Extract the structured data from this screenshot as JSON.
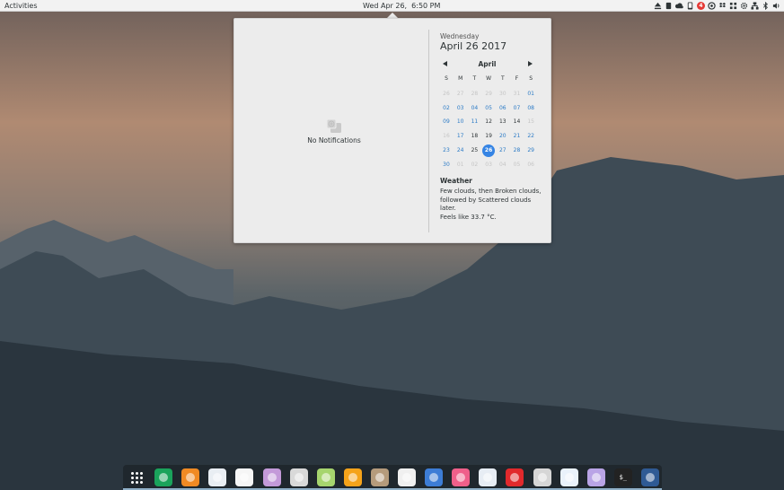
{
  "topbar": {
    "activities_label": "Activities",
    "clock": "Wed Apr 26,  6:50 PM",
    "tray": {
      "notification_count": "4",
      "icons": [
        "eject-icon",
        "battery-icon",
        "cloud-icon",
        "phone-icon",
        "notification-badge",
        "steam-icon",
        "dropbox-icon",
        "grid-apps-icon",
        "settings-cog-icon",
        "network-icon",
        "bluetooth-icon",
        "volume-icon"
      ]
    }
  },
  "notifications": {
    "empty_label": "No Notifications"
  },
  "calendar": {
    "weekday": "Wednesday",
    "full_date": "April 26 2017",
    "month": "April",
    "day_headers": [
      "S",
      "M",
      "T",
      "W",
      "T",
      "F",
      "S"
    ],
    "weeks": [
      [
        {
          "d": "26",
          "o": true
        },
        {
          "d": "27",
          "o": true
        },
        {
          "d": "28",
          "o": true
        },
        {
          "d": "29",
          "o": true
        },
        {
          "d": "30",
          "o": true
        },
        {
          "d": "31",
          "o": true
        },
        {
          "d": "01",
          "w": true
        }
      ],
      [
        {
          "d": "02",
          "w": true
        },
        {
          "d": "03",
          "w": true
        },
        {
          "d": "04",
          "w": true
        },
        {
          "d": "05",
          "w": true
        },
        {
          "d": "06",
          "w": true
        },
        {
          "d": "07",
          "w": true
        },
        {
          "d": "08",
          "w": true
        }
      ],
      [
        {
          "d": "09",
          "w": true
        },
        {
          "d": "10",
          "w": true
        },
        {
          "d": "11",
          "w": true
        },
        {
          "d": "12"
        },
        {
          "d": "13"
        },
        {
          "d": "14"
        },
        {
          "d": "15",
          "o": true
        }
      ],
      [
        {
          "d": "16",
          "o": true
        },
        {
          "d": "17",
          "w": true
        },
        {
          "d": "18"
        },
        {
          "d": "19"
        },
        {
          "d": "20",
          "w": true
        },
        {
          "d": "21",
          "w": true
        },
        {
          "d": "22",
          "w": true
        }
      ],
      [
        {
          "d": "23",
          "w": true
        },
        {
          "d": "24",
          "w": true
        },
        {
          "d": "25"
        },
        {
          "d": "26",
          "t": true
        },
        {
          "d": "27",
          "w": true
        },
        {
          "d": "28",
          "w": true
        },
        {
          "d": "29",
          "w": true
        }
      ],
      [
        {
          "d": "30",
          "w": true
        },
        {
          "d": "01",
          "o": true
        },
        {
          "d": "02",
          "o": true
        },
        {
          "d": "03",
          "o": true
        },
        {
          "d": "04",
          "o": true
        },
        {
          "d": "05",
          "o": true
        },
        {
          "d": "06",
          "o": true
        }
      ]
    ]
  },
  "weather": {
    "title": "Weather",
    "line1": "Few clouds, then Broken clouds,",
    "line2": "followed by Scattered clouds later.",
    "line3": "Feels like 33.7 °C."
  },
  "dock": {
    "items": [
      {
        "name": "show-apps-icon",
        "color": "transparent"
      },
      {
        "name": "vpn-shield-icon",
        "color": "#1aa35b"
      },
      {
        "name": "firefox-icon",
        "color": "#f08a24"
      },
      {
        "name": "messenger-icon",
        "color": "#e9eef3"
      },
      {
        "name": "music-icon",
        "color": "#f6f6f6"
      },
      {
        "name": "files-icon",
        "color": "#c49ad9"
      },
      {
        "name": "phone-icon",
        "color": "#d9d9d9"
      },
      {
        "name": "atom-icon",
        "color": "#a6d56e"
      },
      {
        "name": "notes-icon",
        "color": "#f5a31a"
      },
      {
        "name": "gimp-icon",
        "color": "#b59b7c"
      },
      {
        "name": "inkscape-icon",
        "color": "#f0f0f0"
      },
      {
        "name": "drawing-icon",
        "color": "#3d7dd6"
      },
      {
        "name": "color-picker-icon",
        "color": "#ef5f8a"
      },
      {
        "name": "document-viewer-icon",
        "color": "#e7edf4"
      },
      {
        "name": "git-icon",
        "color": "#e1292c"
      },
      {
        "name": "disks-icon",
        "color": "#d6d6d6"
      },
      {
        "name": "web-browser-icon",
        "color": "#eaf2fb"
      },
      {
        "name": "text-editor-icon",
        "color": "#b9a4e6"
      },
      {
        "name": "terminal-icon",
        "color": "#222222"
      },
      {
        "name": "water-drop-icon",
        "color": "#2f5a94"
      }
    ],
    "terminal_prompt": "$_"
  }
}
